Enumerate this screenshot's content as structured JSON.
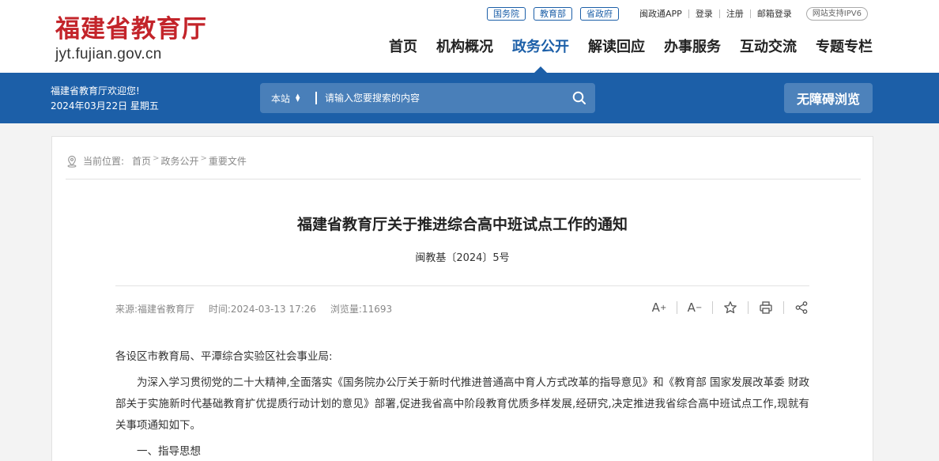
{
  "header": {
    "logo_cn": "福建省教育厅",
    "logo_en": "jyt.fujian.gov.cn",
    "gov_links": [
      "国务院",
      "教育部",
      "省政府"
    ],
    "top_links": [
      "闽政通APP",
      "登录",
      "注册",
      "邮箱登录"
    ],
    "ipv6": "网站支持IPV6",
    "nav": [
      "首页",
      "机构概况",
      "政务公开",
      "解读回应",
      "办事服务",
      "互动交流",
      "专题专栏"
    ],
    "active_nav": "政务公开"
  },
  "bar": {
    "welcome": "福建省教育厅欢迎您!",
    "date": "2024年03月22日 星期五",
    "scope": "本站",
    "search_placeholder": "请输入您要搜索的内容",
    "accessible": "无障碍浏览"
  },
  "breadcrumb": {
    "label": "当前位置:",
    "items": [
      "首页",
      "政务公开",
      "重要文件"
    ]
  },
  "article": {
    "title": "福建省教育厅关于推进综合高中班试点工作的通知",
    "doc_number": "闽教基〔2024〕5号",
    "source": "来源:福建省教育厅",
    "time": "时间:2024-03-13 17:26",
    "views": "浏览量:11693",
    "tools": {
      "font_up": "A",
      "font_down": "A"
    },
    "salutation": "各设区市教育局、平潭综合实验区社会事业局:",
    "paragraph1": "为深入学习贯彻党的二十大精神,全面落实《国务院办公厅关于新时代推进普通高中育人方式改革的指导意见》和《教育部 国家发展改革委 财政部关于实施新时代基础教育扩优提质行动计划的意见》部署,促进我省高中阶段教育优质多样发展,经研究,决定推进我省综合高中班试点工作,现就有关事项通知如下。",
    "section1": "一、指导思想"
  },
  "colors": {
    "brand_red": "#c3242a",
    "brand_blue": "#1c5fa8"
  }
}
